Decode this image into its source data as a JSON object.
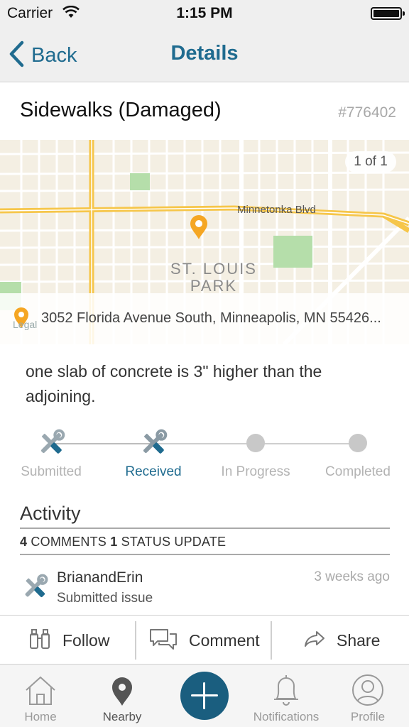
{
  "status_bar": {
    "carrier": "Carrier",
    "time": "1:15 PM"
  },
  "nav": {
    "back_label": "Back",
    "title": "Details"
  },
  "issue": {
    "title": "Sidewalks (Damaged)",
    "id": "#776402"
  },
  "map": {
    "photo_counter": "1 of 1",
    "street_label": "Minnetonka Blvd",
    "area_label_line1": "ST. LOUIS",
    "area_label_line2": "PARK",
    "legal": "Legal",
    "address": "3052 Florida Avenue South, Minneapolis, MN 55426..."
  },
  "description": "one slab of concrete is 3\" higher than the adjoining.",
  "progress": {
    "steps": [
      {
        "label": "Submitted",
        "state": "done"
      },
      {
        "label": "Received",
        "state": "current"
      },
      {
        "label": "In Progress",
        "state": "pending"
      },
      {
        "label": "Completed",
        "state": "pending"
      }
    ]
  },
  "activity": {
    "title": "Activity",
    "comments_count": "4",
    "comments_label": "COMMENTS",
    "status_count": "1",
    "status_label": "STATUS UPDATE",
    "items": [
      {
        "user": "BrianandErin",
        "action": "Submitted issue",
        "time": "3 weeks ago"
      }
    ]
  },
  "actions": {
    "follow": "Follow",
    "comment": "Comment",
    "share": "Share"
  },
  "tabs": [
    {
      "label": "Home"
    },
    {
      "label": "Nearby"
    },
    {
      "label": "Notifications"
    },
    {
      "label": "Profile"
    }
  ],
  "colors": {
    "accent": "#1f6b8f",
    "fab": "#1a5e7f",
    "pin": "#f5a623",
    "road": "#f6c64a"
  }
}
